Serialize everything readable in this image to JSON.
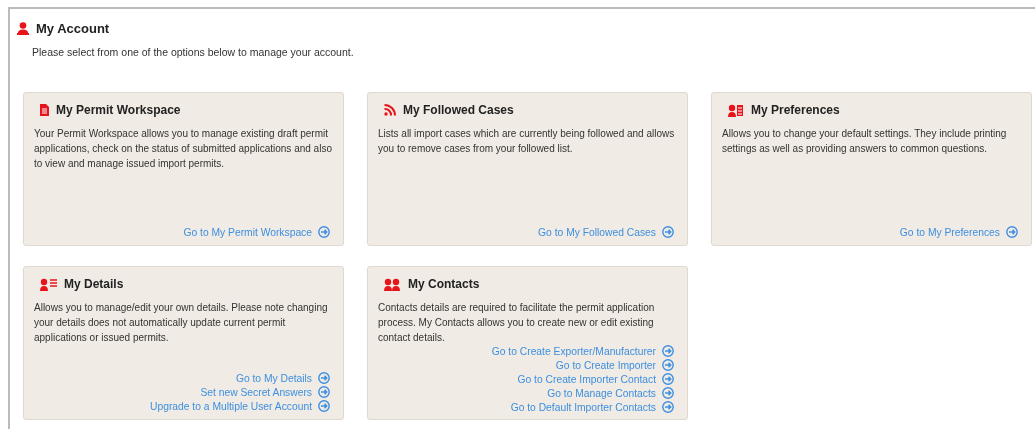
{
  "header": {
    "title": "My Account",
    "intro": "Please select from one of the options below to manage your account."
  },
  "cards": [
    {
      "kind": "document",
      "title": "My Permit Workspace",
      "description": "Your Permit Workspace allows you to manage existing draft permit applications, check on the status of submitted applications and also to view and manage issued import permits.",
      "links": [
        "Go to My Permit Workspace"
      ]
    },
    {
      "kind": "feed",
      "title": "My Followed Cases",
      "description": "Lists all import cases which are currently being followed and allows you to remove cases from your followed list.",
      "links": [
        "Go to My Followed Cases"
      ]
    },
    {
      "kind": "preferences",
      "title": "My Preferences",
      "description": "Allows you to change your default settings. They include printing settings as well as providing answers to common questions.",
      "links": [
        "Go to My Preferences"
      ]
    },
    {
      "kind": "details",
      "title": "My Details",
      "description": "Allows you to manage/edit your own details. Please note changing your details does not automatically update current permit applications or issued permits.",
      "links": [
        "Go to My Details",
        "Set new Secret Answers",
        "Upgrade to a Multiple User Account"
      ]
    },
    {
      "kind": "contacts",
      "title": "My Contacts",
      "description": "Contacts details are required to facilitate the permit application process. My Contacts allows you to create new or edit existing contact details.",
      "links": [
        "Go to Create Exporter/Manufacturer",
        "Go to Create Importer",
        "Go to Create Importer Contact",
        "Go to Manage Contacts",
        "Go to Default Importer Contacts"
      ]
    }
  ]
}
